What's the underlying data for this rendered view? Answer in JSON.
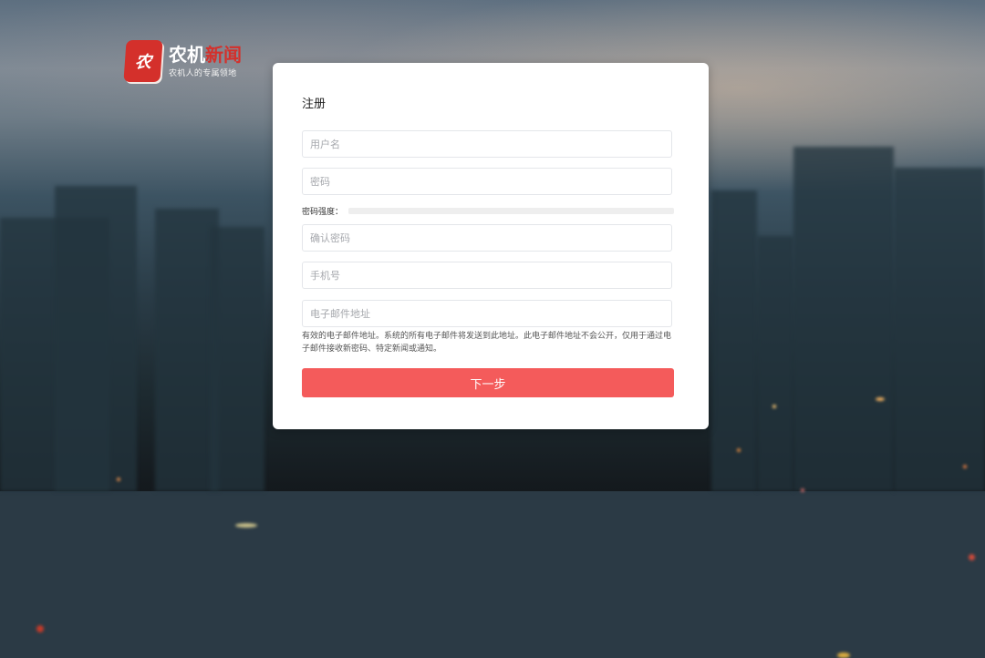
{
  "brand": {
    "logo_char": "农",
    "name_part1": "农机",
    "name_part2": "新闻",
    "slogan": "农机人的专属领地",
    "accent": "#d4302b"
  },
  "form": {
    "title": "注册",
    "username_placeholder": "用户名",
    "password_placeholder": "密码",
    "strength_label": "密码强度：",
    "strength_level": 0,
    "confirm_placeholder": "确认密码",
    "phone_placeholder": "手机号",
    "email_placeholder": "电子邮件地址",
    "email_hint": "有效的电子邮件地址。系统的所有电子邮件将发送到此地址。此电子邮件地址不会公开，仅用于通过电子邮件接收新密码、特定新闻或通知。",
    "next_label": "下一步",
    "button_color": "#f45b5b"
  }
}
